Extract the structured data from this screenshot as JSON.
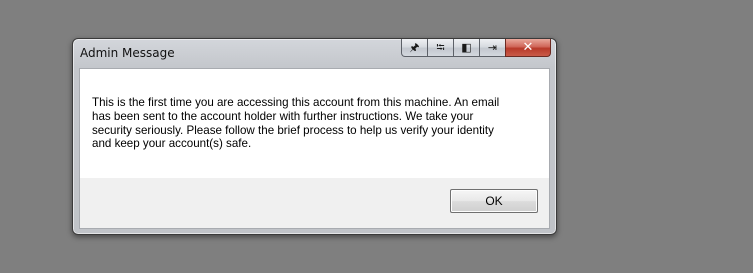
{
  "window": {
    "title": "Admin Message"
  },
  "caption_buttons": [
    {
      "icon": "pin-icon",
      "glyph": "🖈"
    },
    {
      "icon": "usb-icon",
      "glyph": "⭾"
    },
    {
      "icon": "panel-icon",
      "glyph": "◧"
    },
    {
      "icon": "exit-icon",
      "glyph": "⇥"
    },
    {
      "icon": "close-icon",
      "glyph": "✕"
    }
  ],
  "message": {
    "lines": [
      "This is the first time you are accessing this account from this machine. An email",
      "has been sent to the account holder with further instructions.  We take your",
      "security seriously.  Please follow the brief process to help us verify your identity",
      "and keep your account(s) safe."
    ]
  },
  "buttons": {
    "ok_label": "OK"
  },
  "colors": {
    "desktop": "#7f7f7f",
    "close_button": "#c9483a"
  }
}
